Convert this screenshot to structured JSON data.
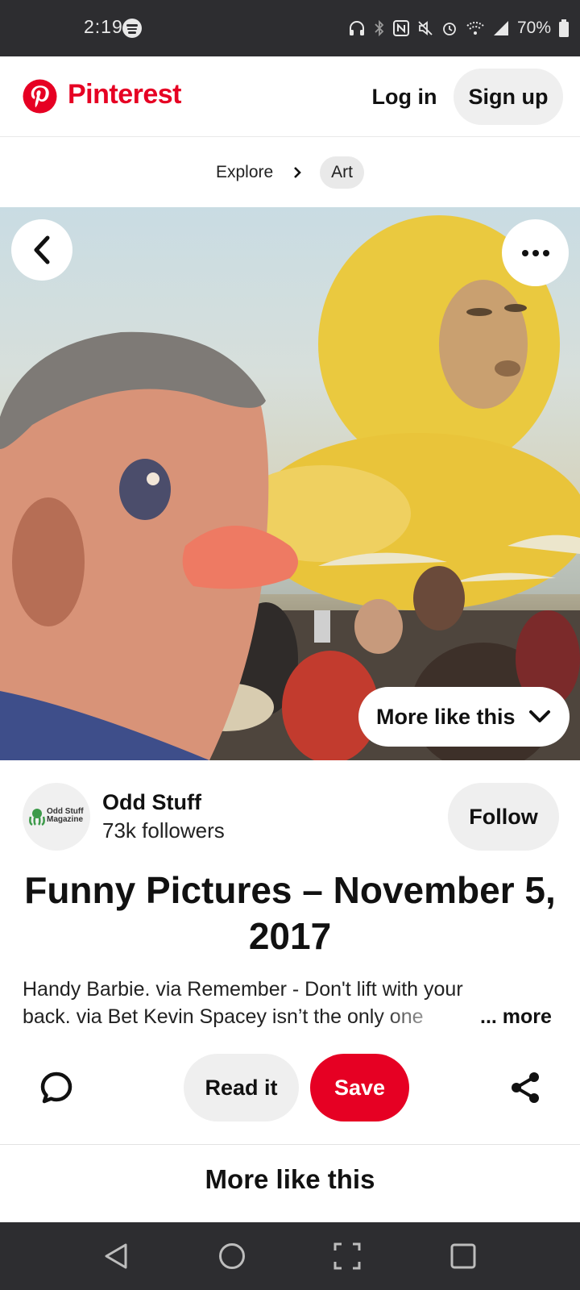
{
  "status_bar": {
    "time": "2:19",
    "battery": "70%"
  },
  "header": {
    "brand": "Pinterest",
    "login_label": "Log in",
    "signup_label": "Sign up"
  },
  "breadcrumb": {
    "items": [
      "Explore",
      "Art"
    ]
  },
  "pin": {
    "more_like_this_button": "More like this",
    "creator": {
      "name": "Odd Stuff",
      "followers": "73k followers",
      "avatar_text_line1": "Odd Stuff",
      "avatar_text_line2": "Magazine"
    },
    "follow_label": "Follow",
    "title": "Funny Pictures – November 5, 2017",
    "description": "Handy Barbie. via Remember - Don't lift with your back. via Bet Kevin Spacey isn’t the only one",
    "more_label": "... more",
    "read_it_label": "Read it",
    "save_label": "Save"
  },
  "section": {
    "more_like_this_heading": "More like this"
  },
  "colors": {
    "brand_red": "#e60023",
    "status_bar_bg": "#2d2d30",
    "pill_gray": "#efefef"
  },
  "icons": [
    "spotify-icon",
    "headphones-icon",
    "bluetooth-icon",
    "nfc-icon",
    "mute-icon",
    "alarm-icon",
    "wifi-icon",
    "signal-icon",
    "battery-icon",
    "pinterest-logo-icon",
    "chevron-right-icon",
    "back-arrow-icon",
    "more-dots-icon",
    "chevron-down-icon",
    "comment-icon",
    "share-icon",
    "nav-back-icon",
    "nav-home-icon",
    "nav-screenshot-icon",
    "nav-recents-icon"
  ]
}
